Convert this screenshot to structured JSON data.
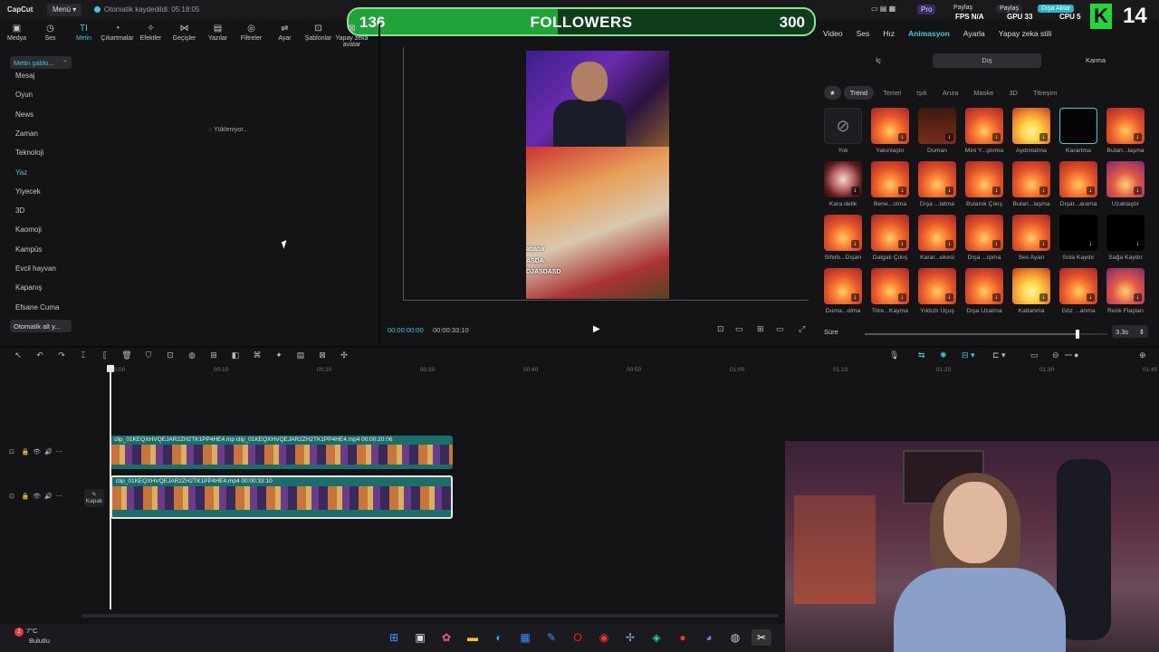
{
  "topbar": {
    "logo": "CapCut",
    "menu_label": "Menü",
    "autosave": "Otomatik kaydedildi: 05:18:05",
    "followers": {
      "current": "136",
      "label": "FOLLOWERS",
      "goal": "300",
      "progress": 0.45
    },
    "right_pro": "Pro",
    "share1": "Paylaş",
    "share2": "Paylaş",
    "export": "Dışa Aktar",
    "fps": "FPS N/A",
    "gpu": "GPU 33",
    "cpu": "CPU 5",
    "k_badge": "K",
    "k_number": "14"
  },
  "tool_tabs": [
    {
      "label": "Medya",
      "icon": "media-icon",
      "glyph": "▣"
    },
    {
      "label": "Ses",
      "icon": "audio-icon",
      "glyph": "◷"
    },
    {
      "label": "Metin",
      "icon": "text-icon",
      "glyph": "TI",
      "active": true
    },
    {
      "label": "Çıkartmalar",
      "icon": "sticker-icon",
      "glyph": "◔"
    },
    {
      "label": "Efektler",
      "icon": "effects-icon",
      "glyph": "✧"
    },
    {
      "label": "Geçişler",
      "icon": "transitions-icon",
      "glyph": "⋈"
    },
    {
      "label": "Yazılar",
      "icon": "captions-icon",
      "glyph": "▤"
    },
    {
      "label": "Filtreler",
      "icon": "filters-icon",
      "glyph": "◎"
    },
    {
      "label": "Ayar",
      "icon": "adjust-icon",
      "glyph": "⇌"
    },
    {
      "label": "Şablonlar",
      "icon": "templates-icon",
      "glyph": "⊡"
    },
    {
      "label": "Yapay zekâ avatar",
      "icon": "ai-avatar-icon",
      "glyph": "⊠"
    }
  ],
  "left_panel": {
    "header": "Metin şablo...",
    "categories": [
      "Mesaj",
      "Oyun",
      "News",
      "Zaman",
      "Teknoloji",
      "Yaz",
      "Yiyecek",
      "3D",
      "Kaomoji",
      "Kampüs",
      "Evcil hayvan",
      "Kapanış",
      "Efsane Cuma"
    ],
    "active_category": "Yaz",
    "last": "Otomatik alt y...",
    "loading": "Yükleniyor..."
  },
  "preview": {
    "overlay_lines": [
      "ababa",
      "ASDA",
      "DJASDASD"
    ],
    "time_current": "00:00:00:00",
    "time_total": "00:00:33:10"
  },
  "right_panel": {
    "tabs": [
      "Video",
      "Ses",
      "Hız",
      "Animasyon",
      "Ayarla",
      "Yapay zeka stili"
    ],
    "active_tab": "Animasyon",
    "segments": [
      "İç",
      "Dış",
      "Karma"
    ],
    "active_segment": "Dış",
    "chips": [
      "Trend",
      "Temel",
      "Işık",
      "Arıza",
      "Maske",
      "3D",
      "Titreşim"
    ],
    "active_chip": "Trend",
    "effects": [
      {
        "label": "Yok",
        "style": "none"
      },
      {
        "label": "Yakınlaştır",
        "style": "fire"
      },
      {
        "label": "Duman",
        "style": "dark"
      },
      {
        "label": "Mini Y...ştırma",
        "style": "fire"
      },
      {
        "label": "Aydınlatma",
        "style": "bright"
      },
      {
        "label": "Karartma",
        "style": "black"
      },
      {
        "label": "Bulan...laşma",
        "style": "fire"
      },
      {
        "label": "Kara delik",
        "style": "ring"
      },
      {
        "label": "Bene...olma",
        "style": "fire"
      },
      {
        "label": "Dışa ...latma",
        "style": "fire"
      },
      {
        "label": "Bulanık Çıkış",
        "style": "fire"
      },
      {
        "label": "Bulan...laşma",
        "style": "fire"
      },
      {
        "label": "Dışar...arama",
        "style": "fire"
      },
      {
        "label": "Uzaklaştır",
        "style": "purple"
      },
      {
        "label": "Sihirb...Dışarı",
        "style": "fire"
      },
      {
        "label": "Dalgalı Çıkış",
        "style": "fire"
      },
      {
        "label": "Karar...ekesi",
        "style": "fire"
      },
      {
        "label": "Dışa ...rpma",
        "style": "fire"
      },
      {
        "label": "Ses Ayarı",
        "style": "fire"
      },
      {
        "label": "Sola Kaydır",
        "style": "blk"
      },
      {
        "label": "Sağa Kaydır",
        "style": "blk"
      },
      {
        "label": "Duma...olma",
        "style": "fire"
      },
      {
        "label": "Titre...Kayma",
        "style": "fire"
      },
      {
        "label": "Yıldızlı Uçuş",
        "style": "fire"
      },
      {
        "label": "Dışa Uzatma",
        "style": "fire"
      },
      {
        "label": "Katlanma",
        "style": "bright"
      },
      {
        "label": "Göz ...anma",
        "style": "fire"
      },
      {
        "label": "Renk Flaşları",
        "style": "purple"
      }
    ],
    "duration_label": "Süre",
    "duration_value": "3.3s"
  },
  "timeline": {
    "ticks": [
      "00:00",
      "00:10",
      "00:20",
      "00:30",
      "00:40",
      "00:50",
      "01:00",
      "01:10",
      "01:20",
      "01:30",
      "01:40"
    ],
    "clip_top_title": "clip_01KEQXHVQEJAR2ZH2TK1PP4HE4.mp  clip_01KEQXHVQEJAR2ZH2TK1PP4HE4.mp4  00:00:20:06",
    "clip_main_title": "clip_01KEQXHVQEJAR2ZH2TK1PP4HE4.mp4  00:00:33:10",
    "cover_label": "Kapak"
  },
  "taskbar": {
    "temp": "7°C",
    "condition": "Bulutlu",
    "badge": "2"
  }
}
